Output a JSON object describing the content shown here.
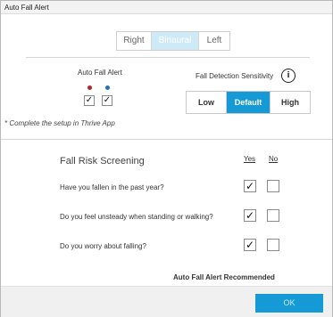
{
  "window": {
    "title": "Auto Fall Alert"
  },
  "side_selector": {
    "options": [
      "Right",
      "Binaural",
      "Left"
    ],
    "selected": "Binaural"
  },
  "auto_fall_alert": {
    "label": "Auto Fall Alert",
    "left_dot_color": "#b0282c",
    "right_dot_color": "#1f73b7",
    "left_checked": "✓",
    "right_checked": "✓"
  },
  "sensitivity": {
    "label": "Fall Detection Sensitivity",
    "info_icon": "i",
    "options": [
      "Low",
      "Default",
      "High"
    ],
    "selected": "Default"
  },
  "setup_note": "* Complete the setup in Thrive App",
  "screening": {
    "title": "Fall Risk Screening",
    "yes_header": "Yes",
    "no_header": "No",
    "questions": [
      {
        "text": "Have you fallen in the past year?",
        "yes": "✓",
        "no": ""
      },
      {
        "text": "Do you feel unsteady when standing or walking?",
        "yes": "✓",
        "no": ""
      },
      {
        "text": "Do you worry about falling?",
        "yes": "✓",
        "no": ""
      }
    ],
    "recommendation": "Auto Fall Alert Recommended"
  },
  "footer": {
    "ok_label": "OK"
  },
  "colors": {
    "accent": "#169ad6",
    "segment_active": "#cfeaf7"
  }
}
